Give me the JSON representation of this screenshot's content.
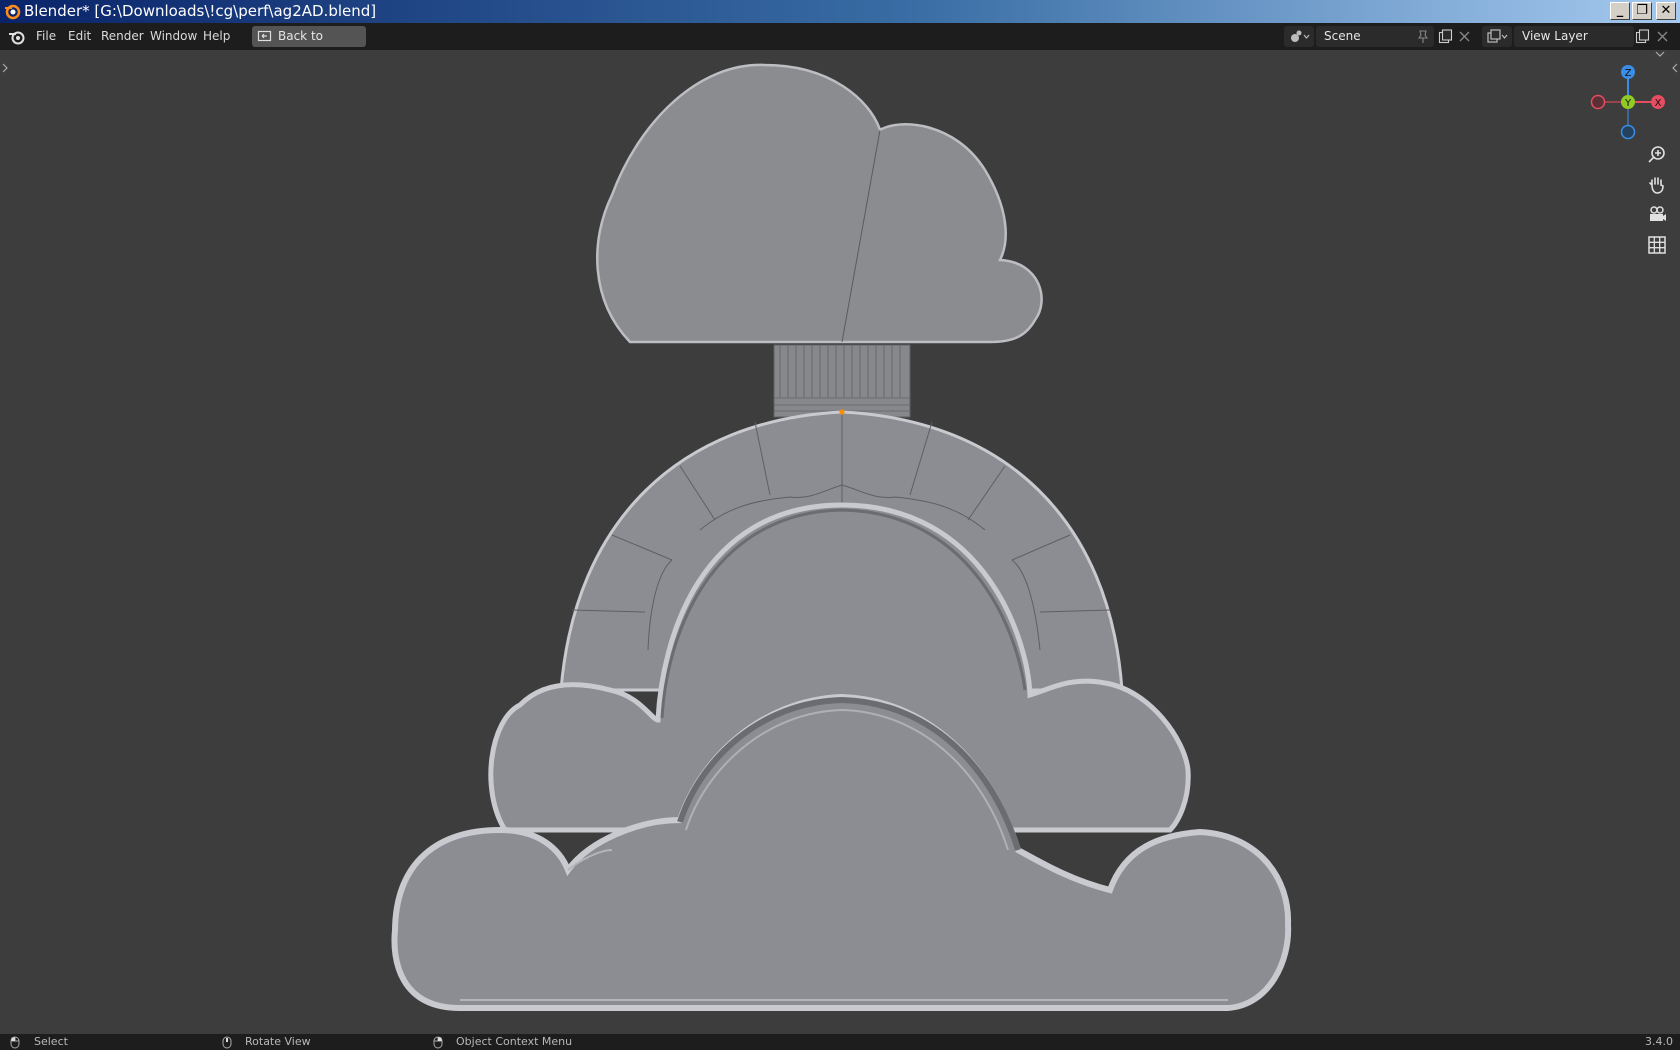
{
  "window": {
    "title": "Blender* [G:\\Downloads\\!cg\\perf\\ag2AD.blend]",
    "minimize_glyph": "_",
    "restore_glyph": "❐",
    "close_glyph": "✕"
  },
  "menu": {
    "items": [
      "File",
      "Edit",
      "Render",
      "Window",
      "Help"
    ],
    "back_button": "Back to Previous"
  },
  "scene_selector": {
    "label": "Scene",
    "icon": "scene-icon"
  },
  "view_layer_selector": {
    "label": "View Layer",
    "icon": "render-layers-icon"
  },
  "gizmo": {
    "axes": [
      "Z",
      "Y",
      "X"
    ]
  },
  "nav_tools": [
    "zoom-icon",
    "hand-pan-icon",
    "camera-icon",
    "grid-icon"
  ],
  "status": {
    "left_action": "Select",
    "middle_action": "Rotate View",
    "right_action": "Object Context Menu",
    "version": "3.4.0"
  },
  "colors": {
    "accent_selected": "#ff8c00",
    "axis_x": "#e64d60",
    "axis_y": "#8fcb22",
    "axis_z": "#3b8ee8",
    "mesh": "#8b8c90"
  }
}
